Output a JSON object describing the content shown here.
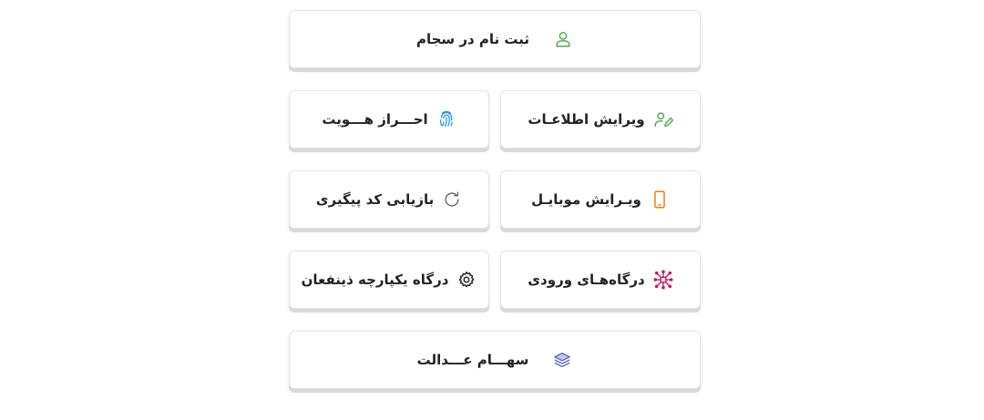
{
  "menu": {
    "register_sejam": {
      "label": "ثبت نام در سجام",
      "icon": "user-icon",
      "color": "#4caf50"
    },
    "edit_info": {
      "label": "ویرایش اطلاعـات",
      "icon": "edit-user-icon",
      "color": "#4caf50"
    },
    "identity_verification": {
      "label": "احـــراز هـــویت",
      "icon": "fingerprint-icon",
      "color": "#2196f3"
    },
    "edit_mobile": {
      "label": "ویـرایش موبایـل",
      "icon": "mobile-icon",
      "color": "#f57c00"
    },
    "recover_tracking_code": {
      "label": "بازیابی کد پیگیری",
      "icon": "refresh-icon",
      "color": "#666666"
    },
    "login_gateways": {
      "label": "درگاه‌هـای ورودی",
      "icon": "network-icon",
      "color": "#c2185b"
    },
    "integrated_gateway": {
      "label": "درگاه یکپارچه ذینفعان",
      "icon": "gear-icon",
      "color": "#222222"
    },
    "justice_shares": {
      "label": "سهـــام عـــدالت",
      "icon": "layers-icon",
      "color": "#5c6bc0"
    }
  }
}
